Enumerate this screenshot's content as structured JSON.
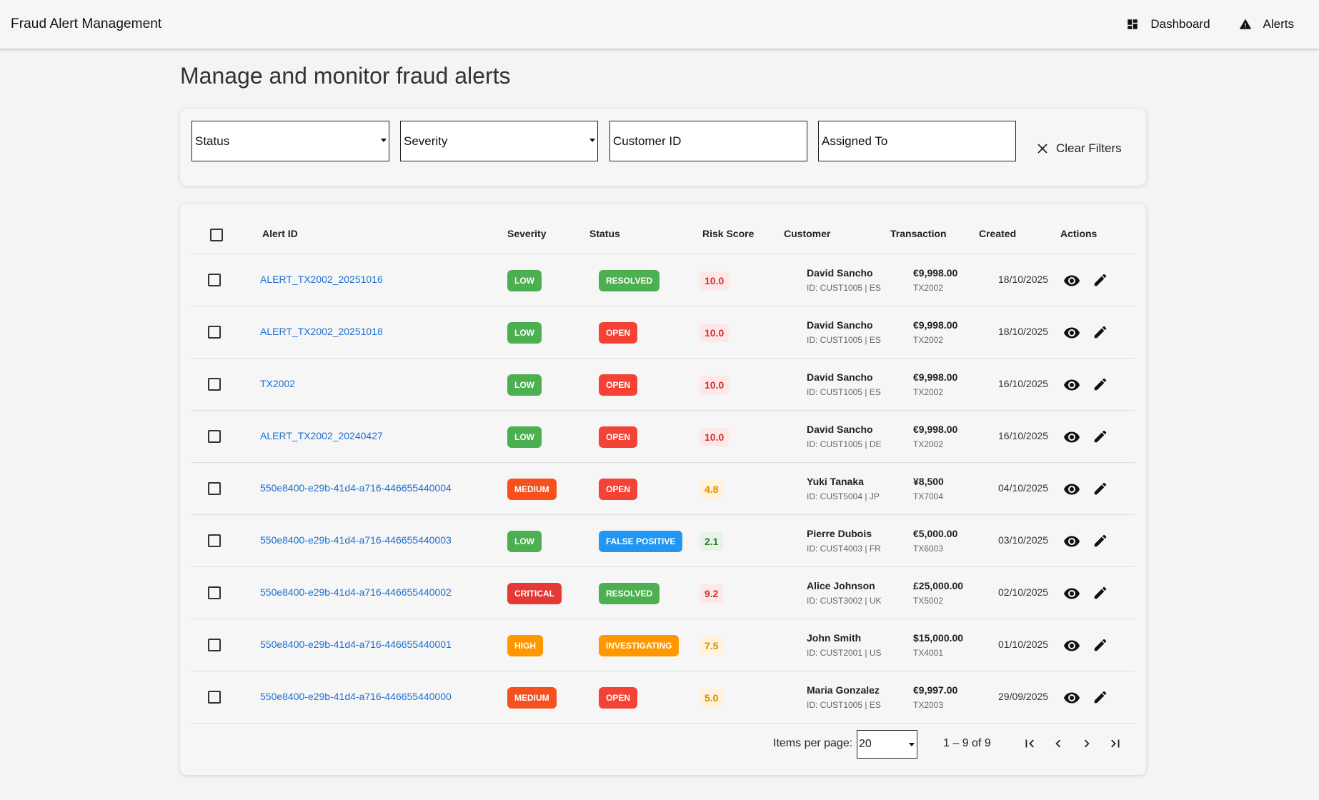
{
  "header": {
    "title": "Fraud Alert Management",
    "nav": [
      {
        "label": "Dashboard",
        "icon": "dashboard-icon"
      },
      {
        "label": "Alerts",
        "icon": "warning-icon"
      }
    ]
  },
  "page": {
    "title": "Manage and monitor fraud alerts"
  },
  "filters": {
    "status": "Status",
    "severity": "Severity",
    "customer_id": "Customer ID",
    "assigned_to": "Assigned To",
    "clear": "Clear Filters"
  },
  "table": {
    "columns": [
      "Alert ID",
      "Severity",
      "Status",
      "Risk Score",
      "Customer",
      "Transaction",
      "Created",
      "Actions"
    ],
    "rows": [
      {
        "alert_id": "ALERT_TX2002_20251016",
        "severity": "LOW",
        "status": "RESOLVED",
        "risk": "10.0",
        "customer": "David Sancho",
        "customer_meta": "ID: CUST1005 | ES",
        "amount": "€9,998.00",
        "txn": "TX2002",
        "created": "18/10/2025"
      },
      {
        "alert_id": "ALERT_TX2002_20251018",
        "severity": "LOW",
        "status": "OPEN",
        "risk": "10.0",
        "customer": "David Sancho",
        "customer_meta": "ID: CUST1005 | ES",
        "amount": "€9,998.00",
        "txn": "TX2002",
        "created": "18/10/2025"
      },
      {
        "alert_id": "TX2002",
        "severity": "LOW",
        "status": "OPEN",
        "risk": "10.0",
        "customer": "David Sancho",
        "customer_meta": "ID: CUST1005 | ES",
        "amount": "€9,998.00",
        "txn": "TX2002",
        "created": "16/10/2025"
      },
      {
        "alert_id": "ALERT_TX2002_20240427",
        "severity": "LOW",
        "status": "OPEN",
        "risk": "10.0",
        "customer": "David Sancho",
        "customer_meta": "ID: CUST1005 | DE",
        "amount": "€9,998.00",
        "txn": "TX2002",
        "created": "16/10/2025"
      },
      {
        "alert_id": "550e8400-e29b-41d4-a716-446655440004",
        "severity": "MEDIUM",
        "status": "OPEN",
        "risk": "4.8",
        "customer": "Yuki Tanaka",
        "customer_meta": "ID: CUST5004 | JP",
        "amount": "¥8,500",
        "txn": "TX7004",
        "created": "04/10/2025"
      },
      {
        "alert_id": "550e8400-e29b-41d4-a716-446655440003",
        "severity": "LOW",
        "status": "FALSE POSITIVE",
        "risk": "2.1",
        "customer": "Pierre Dubois",
        "customer_meta": "ID: CUST4003 | FR",
        "amount": "€5,000.00",
        "txn": "TX6003",
        "created": "03/10/2025"
      },
      {
        "alert_id": "550e8400-e29b-41d4-a716-446655440002",
        "severity": "CRITICAL",
        "status": "RESOLVED",
        "risk": "9.2",
        "customer": "Alice Johnson",
        "customer_meta": "ID: CUST3002 | UK",
        "amount": "£25,000.00",
        "txn": "TX5002",
        "created": "02/10/2025"
      },
      {
        "alert_id": "550e8400-e29b-41d4-a716-446655440001",
        "severity": "HIGH",
        "status": "INVESTIGATING",
        "risk": "7.5",
        "customer": "John Smith",
        "customer_meta": "ID: CUST2001 | US",
        "amount": "$15,000.00",
        "txn": "TX4001",
        "created": "01/10/2025"
      },
      {
        "alert_id": "550e8400-e29b-41d4-a716-446655440000",
        "severity": "MEDIUM",
        "status": "OPEN",
        "risk": "5.0",
        "customer": "Maria Gonzalez",
        "customer_meta": "ID: CUST1005 | ES",
        "amount": "€9,997.00",
        "txn": "TX2003",
        "created": "29/09/2025"
      }
    ]
  },
  "pagination": {
    "items_per_page_label": "Items per page:",
    "items_per_page": "20",
    "range": "1 – 9 of 9"
  },
  "colors": {
    "link": "#1e6fd0",
    "severity": {
      "LOW": "#4caf50",
      "MEDIUM": "#f4511e",
      "HIGH": "#ff9800",
      "CRITICAL": "#e53935"
    },
    "status": {
      "RESOLVED": "#4caf50",
      "OPEN": "#f44336",
      "FALSE POSITIVE": "#2196f3",
      "INVESTIGATING": "#ff9800"
    },
    "risk_high": {
      "bg": "#fde8e8",
      "fg": "#d32f2f"
    },
    "risk_mid": {
      "bg": "#fff3dc",
      "fg": "#e08a00"
    },
    "risk_low": {
      "bg": "#e6f4e6",
      "fg": "#2e7d32"
    }
  }
}
